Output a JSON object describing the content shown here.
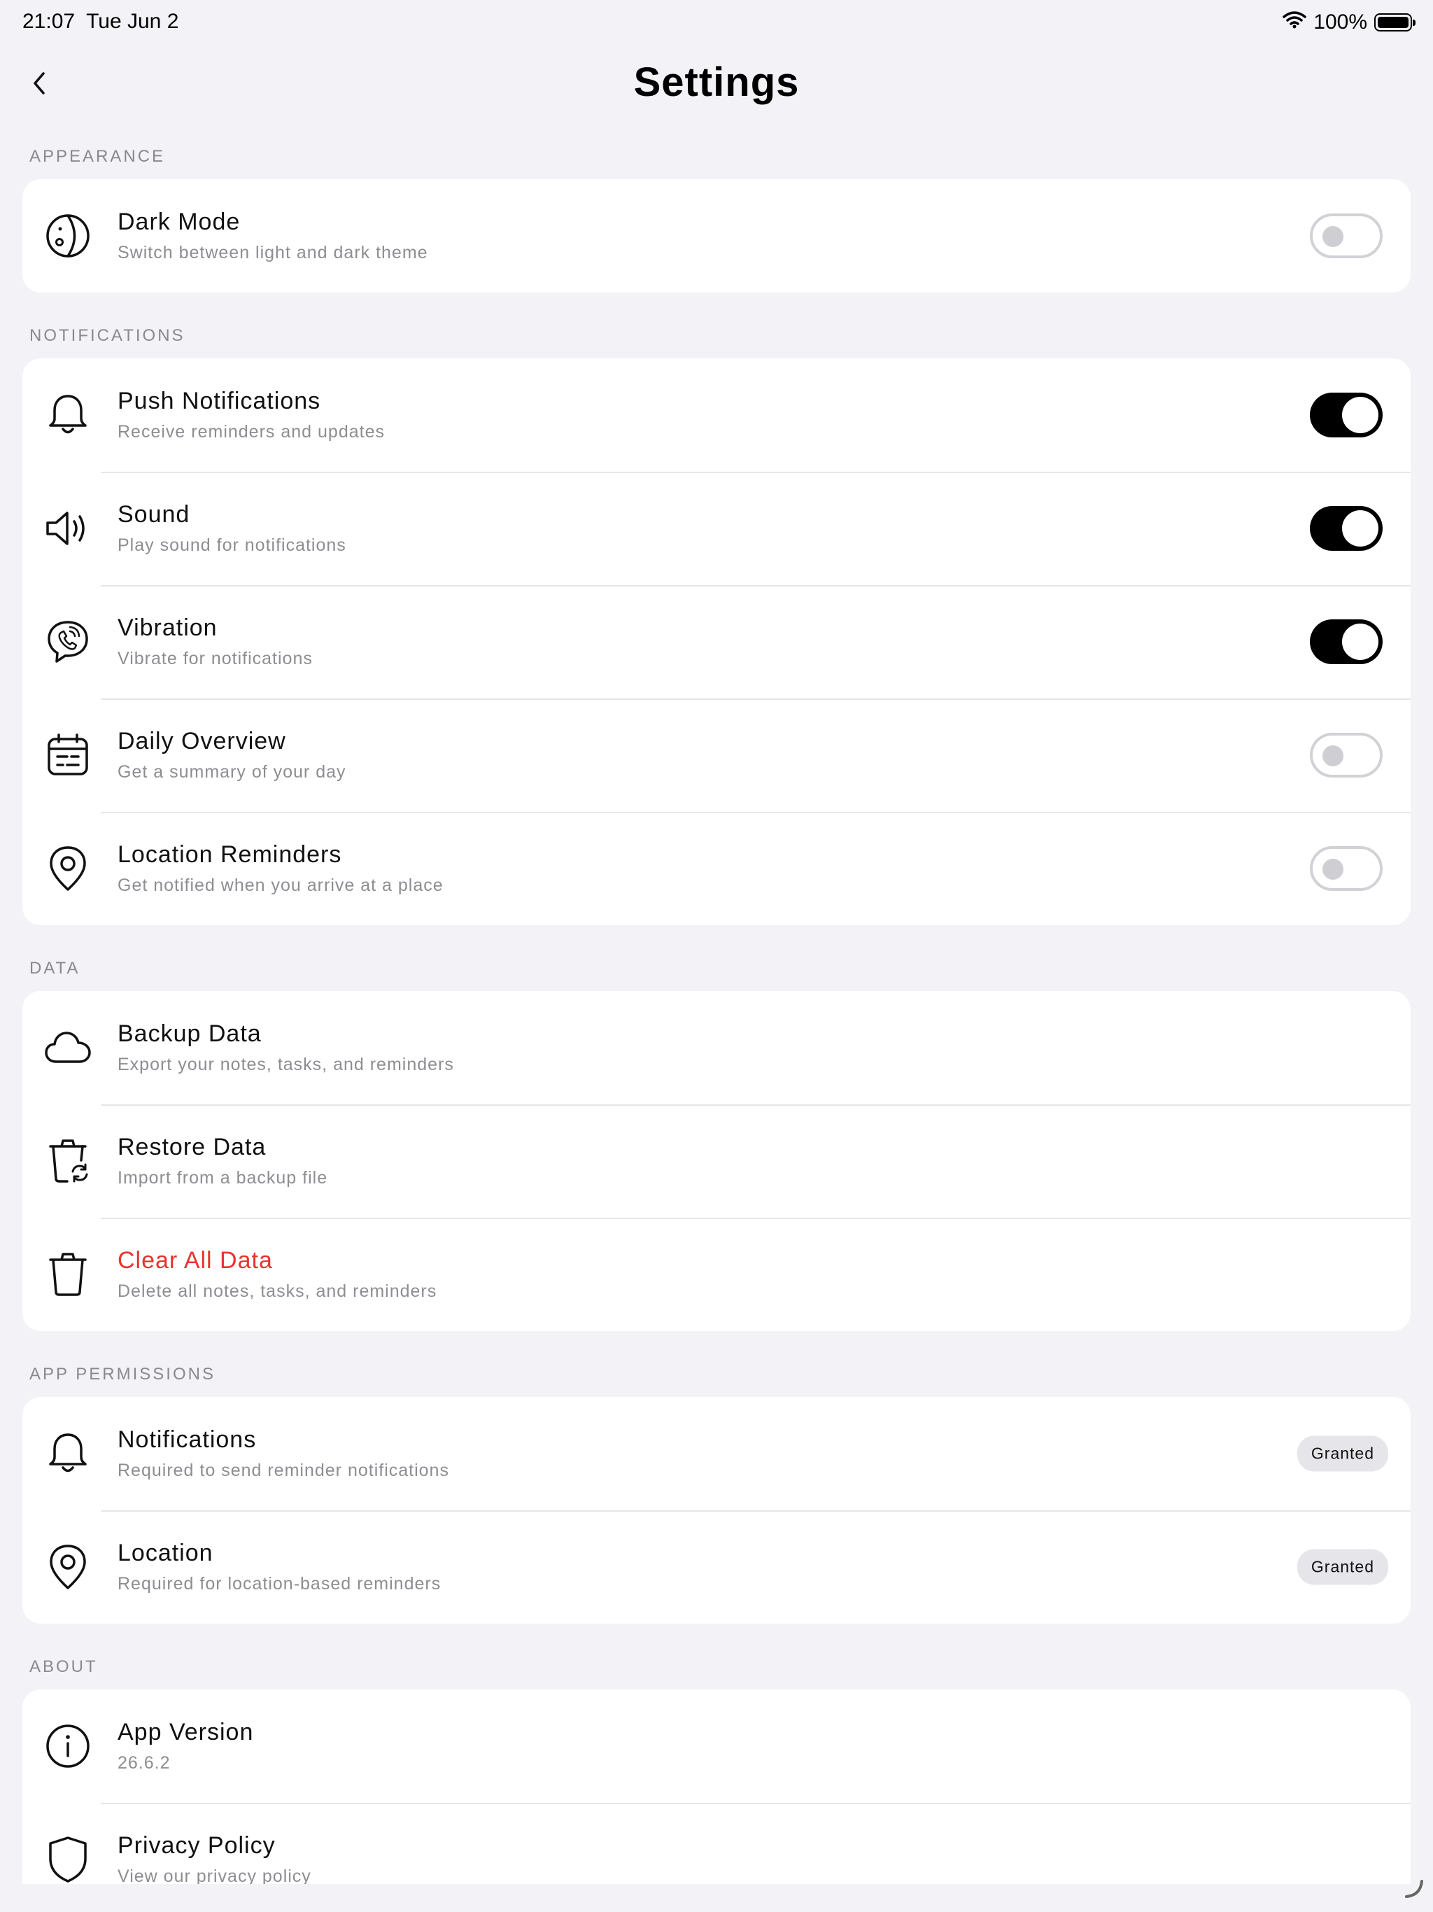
{
  "status_bar": {
    "time": "21:07",
    "date": "Tue Jun 2",
    "battery": "100%"
  },
  "header": {
    "title": "Settings"
  },
  "sections": {
    "appearance": {
      "header": "APPEARANCE",
      "dark_mode": {
        "title": "Dark Mode",
        "subtitle": "Switch between light and dark theme",
        "icon": "moon-face-icon",
        "enabled": false
      }
    },
    "notifications": {
      "header": "NOTIFICATIONS",
      "push": {
        "title": "Push Notifications",
        "subtitle": "Receive reminders and updates",
        "icon": "bell-icon",
        "enabled": true
      },
      "sound": {
        "title": "Sound",
        "subtitle": "Play sound for notifications",
        "icon": "speaker-icon",
        "enabled": true
      },
      "vibration": {
        "title": "Vibration",
        "subtitle": "Vibrate for notifications",
        "icon": "phone-vibrate-icon",
        "enabled": true
      },
      "daily": {
        "title": "Daily Overview",
        "subtitle": "Get a summary of your day",
        "icon": "calendar-icon",
        "enabled": false
      },
      "location": {
        "title": "Location Reminders",
        "subtitle": "Get notified when you arrive at a place",
        "icon": "location-pin-icon",
        "enabled": false
      }
    },
    "data": {
      "header": "DATA",
      "backup": {
        "title": "Backup Data",
        "subtitle": "Export your notes, tasks, and reminders",
        "icon": "cloud-icon"
      },
      "restore": {
        "title": "Restore Data",
        "subtitle": "Import from a backup file",
        "icon": "bin-restore-icon"
      },
      "clear": {
        "title": "Clear All Data",
        "subtitle": "Delete all notes, tasks, and reminders",
        "icon": "trash-icon",
        "color": "#e8332f"
      }
    },
    "permissions": {
      "header": "APP PERMISSIONS",
      "notifications": {
        "title": "Notifications",
        "subtitle": "Required to send reminder notifications",
        "icon": "bell-icon",
        "status": "Granted"
      },
      "location": {
        "title": "Location",
        "subtitle": "Required for location-based reminders",
        "icon": "location-pin-icon",
        "status": "Granted"
      }
    },
    "about": {
      "header": "ABOUT",
      "version": {
        "title": "App Version",
        "subtitle": "26.6.2",
        "icon": "info-icon"
      },
      "privacy": {
        "title": "Privacy Policy",
        "subtitle": "View our privacy policy",
        "icon": "shield-icon"
      }
    }
  }
}
